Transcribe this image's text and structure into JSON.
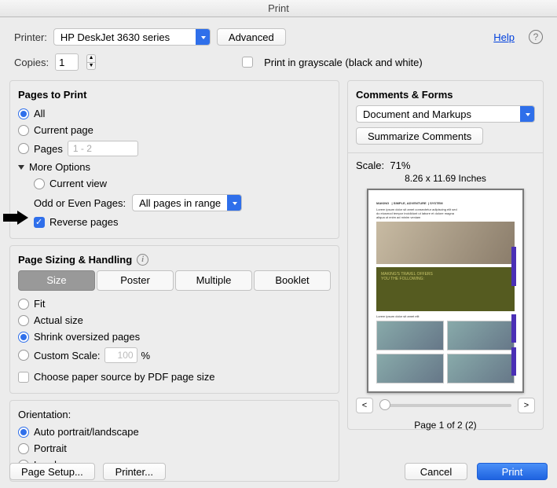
{
  "title": "Print",
  "top": {
    "printer_label": "Printer:",
    "printer_value": "HP DeskJet 3630 series",
    "advanced": "Advanced",
    "help": "Help",
    "copies_label": "Copies:",
    "copies_value": "1",
    "grayscale": "Print in grayscale (black and white)"
  },
  "pages": {
    "title": "Pages to Print",
    "all": "All",
    "current_page": "Current page",
    "pages": "Pages",
    "pages_range": "1 - 2",
    "more_options": "More Options",
    "current_view": "Current view",
    "odd_even_label": "Odd or Even Pages:",
    "odd_even_value": "All pages in range",
    "reverse_pages": "Reverse pages"
  },
  "sizing": {
    "title": "Page Sizing & Handling",
    "size": "Size",
    "poster": "Poster",
    "multiple": "Multiple",
    "booklet": "Booklet",
    "fit": "Fit",
    "actual_size": "Actual size",
    "shrink": "Shrink oversized pages",
    "custom_scale": "Custom Scale:",
    "custom_value": "100",
    "percent": "%",
    "paper_source": "Choose paper source by PDF page size"
  },
  "orientation": {
    "title": "Orientation:",
    "auto": "Auto portrait/landscape",
    "portrait": "Portrait",
    "landscape": "Landscape"
  },
  "comments": {
    "title": "Comments & Forms",
    "value": "Document and Markups",
    "summarize": "Summarize Comments"
  },
  "preview": {
    "scale_label": "Scale:",
    "scale_value": "71%",
    "dims": "8.26 x 11.69 Inches",
    "prev": "<",
    "next": ">",
    "page_text": "Page 1 of 2 (2)"
  },
  "footer": {
    "page_setup": "Page Setup...",
    "printer": "Printer...",
    "cancel": "Cancel",
    "print": "Print"
  }
}
